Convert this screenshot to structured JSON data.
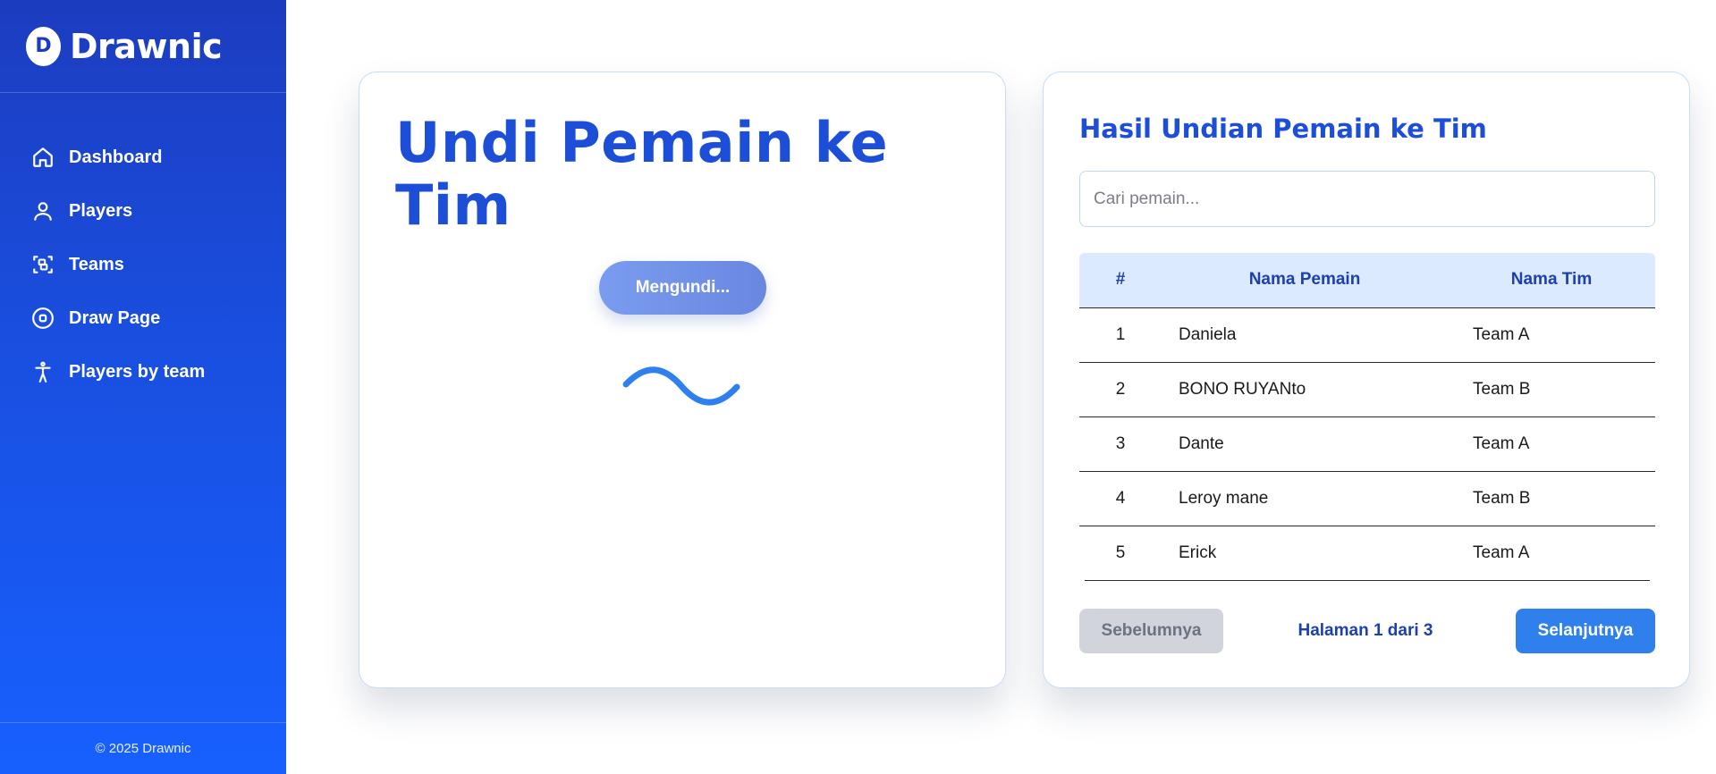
{
  "brand": {
    "logo_letter": "D",
    "name": "Drawnic"
  },
  "sidebar": {
    "items": [
      {
        "label": "Dashboard",
        "icon": "home-icon"
      },
      {
        "label": "Players",
        "icon": "user-icon"
      },
      {
        "label": "Teams",
        "icon": "scan-face-icon"
      },
      {
        "label": "Draw Page",
        "icon": "target-circle-icon"
      },
      {
        "label": "Players by team",
        "icon": "person-standing-icon"
      }
    ],
    "footer": "© 2025 Drawnic"
  },
  "draw": {
    "title": "Undi Pemain ke Tim",
    "button_label": "Mengundi...",
    "spinner_icon": "wave-loading-icon"
  },
  "results": {
    "title": "Hasil Undian Pemain ke Tim",
    "search_placeholder": "Cari pemain...",
    "search_value": "",
    "columns": [
      "#",
      "Nama Pemain",
      "Nama Tim"
    ],
    "rows": [
      {
        "num": "1",
        "name": "Daniela",
        "team": "Team A"
      },
      {
        "num": "2",
        "name": "BONO RUYANto",
        "team": "Team B"
      },
      {
        "num": "3",
        "name": "Dante",
        "team": "Team A"
      },
      {
        "num": "4",
        "name": "Leroy mane",
        "team": "Team B"
      },
      {
        "num": "5",
        "name": "Erick",
        "team": "Team A"
      }
    ],
    "pagination": {
      "prev_label": "Sebelumnya",
      "info": "Halaman 1 dari 3",
      "next_label": "Selanjutnya"
    }
  },
  "colors": {
    "accent": "#1d4ed8",
    "sidebar_top": "#1c3cbf",
    "sidebar_bottom": "#1760ff",
    "next_button": "#2f80ed",
    "table_header_bg": "#dbeafe"
  }
}
